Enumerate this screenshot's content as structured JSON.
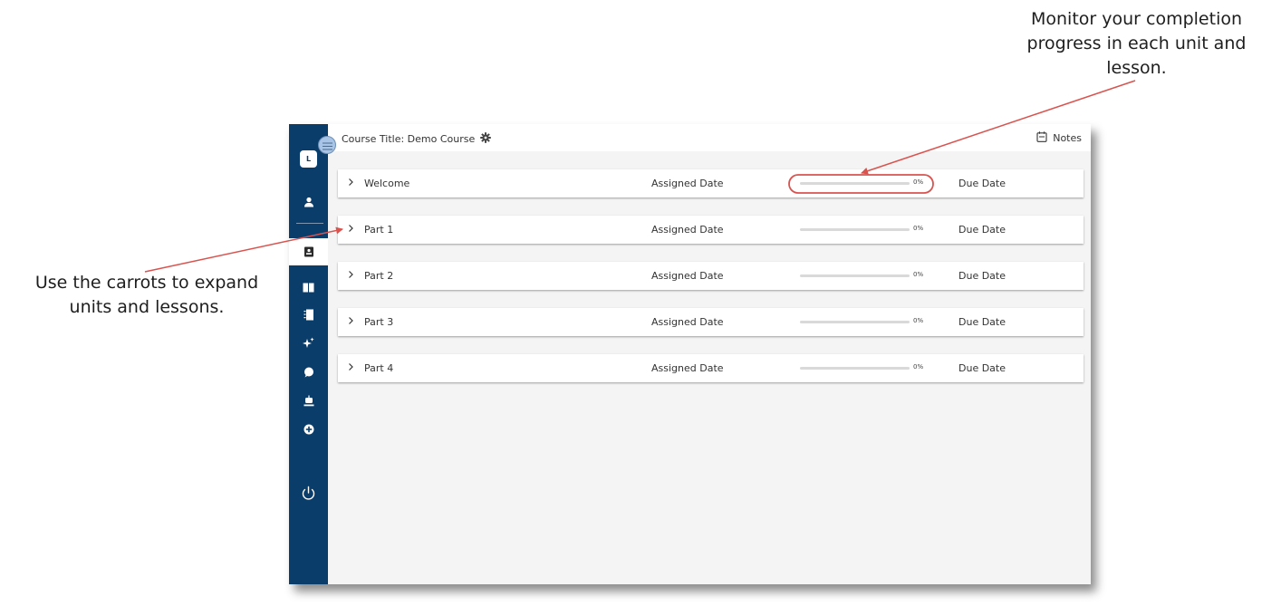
{
  "callouts": {
    "progress": "Monitor your completion progress in each unit and lesson.",
    "carrots": "Use the carrots to expand units and lessons."
  },
  "sidebar": {
    "avatar_initial": "L",
    "items": [
      {
        "icon": "user-icon"
      },
      {
        "icon": "contact-book-icon",
        "active": true
      },
      {
        "icon": "book-open-icon"
      },
      {
        "icon": "notebook-icon"
      },
      {
        "icon": "sparkles-icon"
      },
      {
        "icon": "chat-bubble-icon"
      },
      {
        "icon": "robot-icon"
      },
      {
        "icon": "add-circle-icon"
      },
      {
        "icon": "power-icon"
      }
    ]
  },
  "header": {
    "course_title": "Course Title: Demo Course",
    "notes_label": "Notes"
  },
  "units": [
    {
      "label": "Welcome",
      "assigned": "Assigned Date",
      "progress": "0%",
      "due": "Due Date"
    },
    {
      "label": "Part 1",
      "assigned": "Assigned Date",
      "progress": "0%",
      "due": "Due Date"
    },
    {
      "label": "Part 2",
      "assigned": "Assigned Date",
      "progress": "0%",
      "due": "Due Date"
    },
    {
      "label": "Part 3",
      "assigned": "Assigned Date",
      "progress": "0%",
      "due": "Due Date"
    },
    {
      "label": "Part 4",
      "assigned": "Assigned Date",
      "progress": "0%",
      "due": "Due Date"
    }
  ],
  "colors": {
    "sidebar": "#0b3d6b",
    "annotation": "#d9534f",
    "progress_track": "#d9d9d9"
  }
}
